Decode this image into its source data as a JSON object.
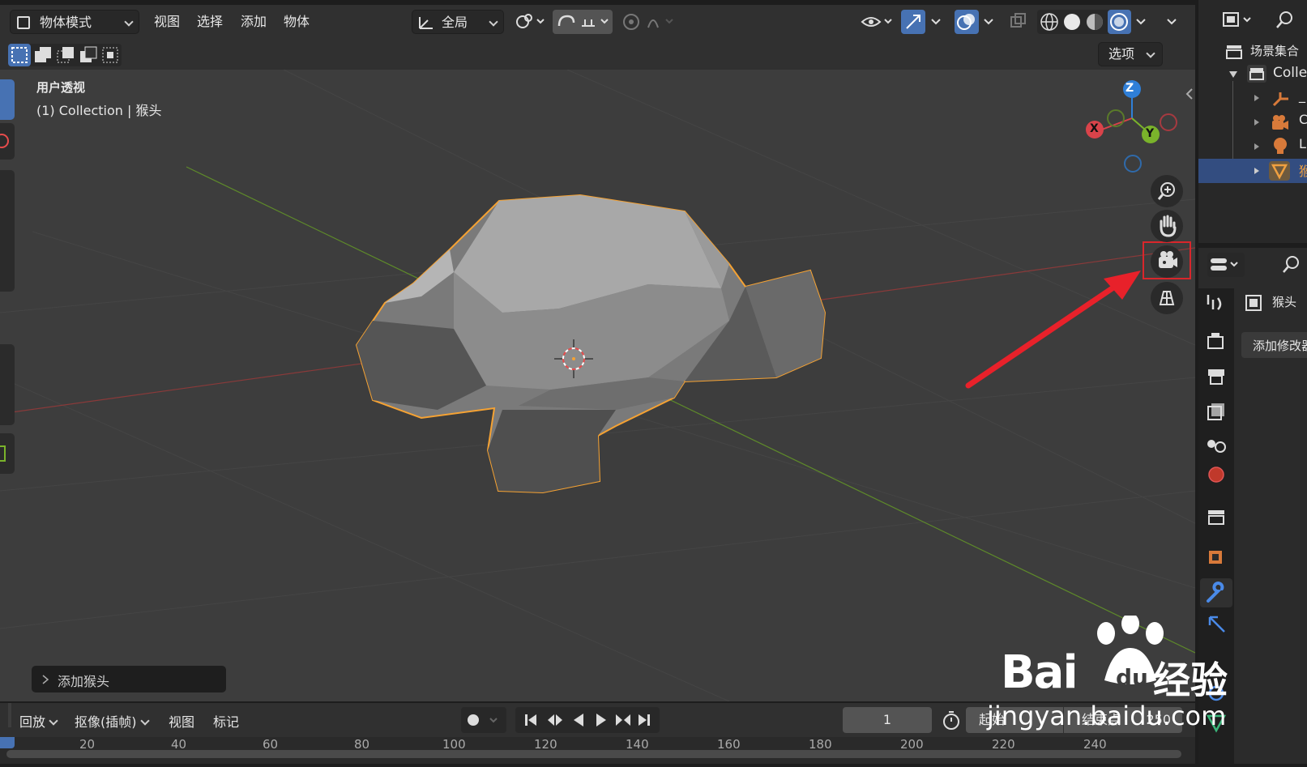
{
  "header": {
    "mode_label": "物体模式",
    "menu": [
      "视图",
      "选择",
      "添加",
      "物体"
    ],
    "orientation_label": "全局",
    "options_label": "选项"
  },
  "viewport": {
    "view_name": "用户透视",
    "object_info": "(1) Collection | 猴头",
    "axis_labels": {
      "x": "X",
      "y": "Y",
      "z": "Z"
    },
    "last_op_label": "添加猴头",
    "nav_buttons": [
      "zoom-icon",
      "hand-pan-icon",
      "camera-view-icon",
      "grid-ortho-icon"
    ]
  },
  "outliner": {
    "scene_collection": "场景集合",
    "collection": "Colle",
    "items": [
      {
        "icon": "armature-icon",
        "label": "_"
      },
      {
        "icon": "camera-icon",
        "label": "C"
      },
      {
        "icon": "light-icon",
        "label": "L"
      },
      {
        "icon": "mesh-icon",
        "label": "猴"
      }
    ]
  },
  "properties": {
    "object_name": "猴头",
    "add_modifier": "添加修改器",
    "tabs": [
      "tool-icon",
      "render-icon",
      "output-icon",
      "view-layer-icon",
      "scene-icon",
      "world-icon",
      "collection-icon",
      "object-icon",
      "modifier-icon",
      "particles-icon",
      "physics-icon",
      "data-icon"
    ]
  },
  "timeline": {
    "playback": "回放",
    "keying": "抠像(插帧)",
    "view": "视图",
    "marker": "标记",
    "current_frame": "1",
    "start_label": "起始",
    "end_label": "结束点",
    "end_value": "250",
    "ruler": [
      "20",
      "40",
      "60",
      "80",
      "100",
      "120",
      "140",
      "160",
      "180",
      "200",
      "220",
      "240"
    ]
  },
  "watermark": {
    "brand": "Bai",
    "brand2": "经验",
    "url": "jingyan.baidu.com"
  },
  "colors": {
    "selection_outline": "#f5a233",
    "highlight_box": "#d9262b",
    "arrow": "#e8212a",
    "active_tab": "#4a8ae8"
  }
}
